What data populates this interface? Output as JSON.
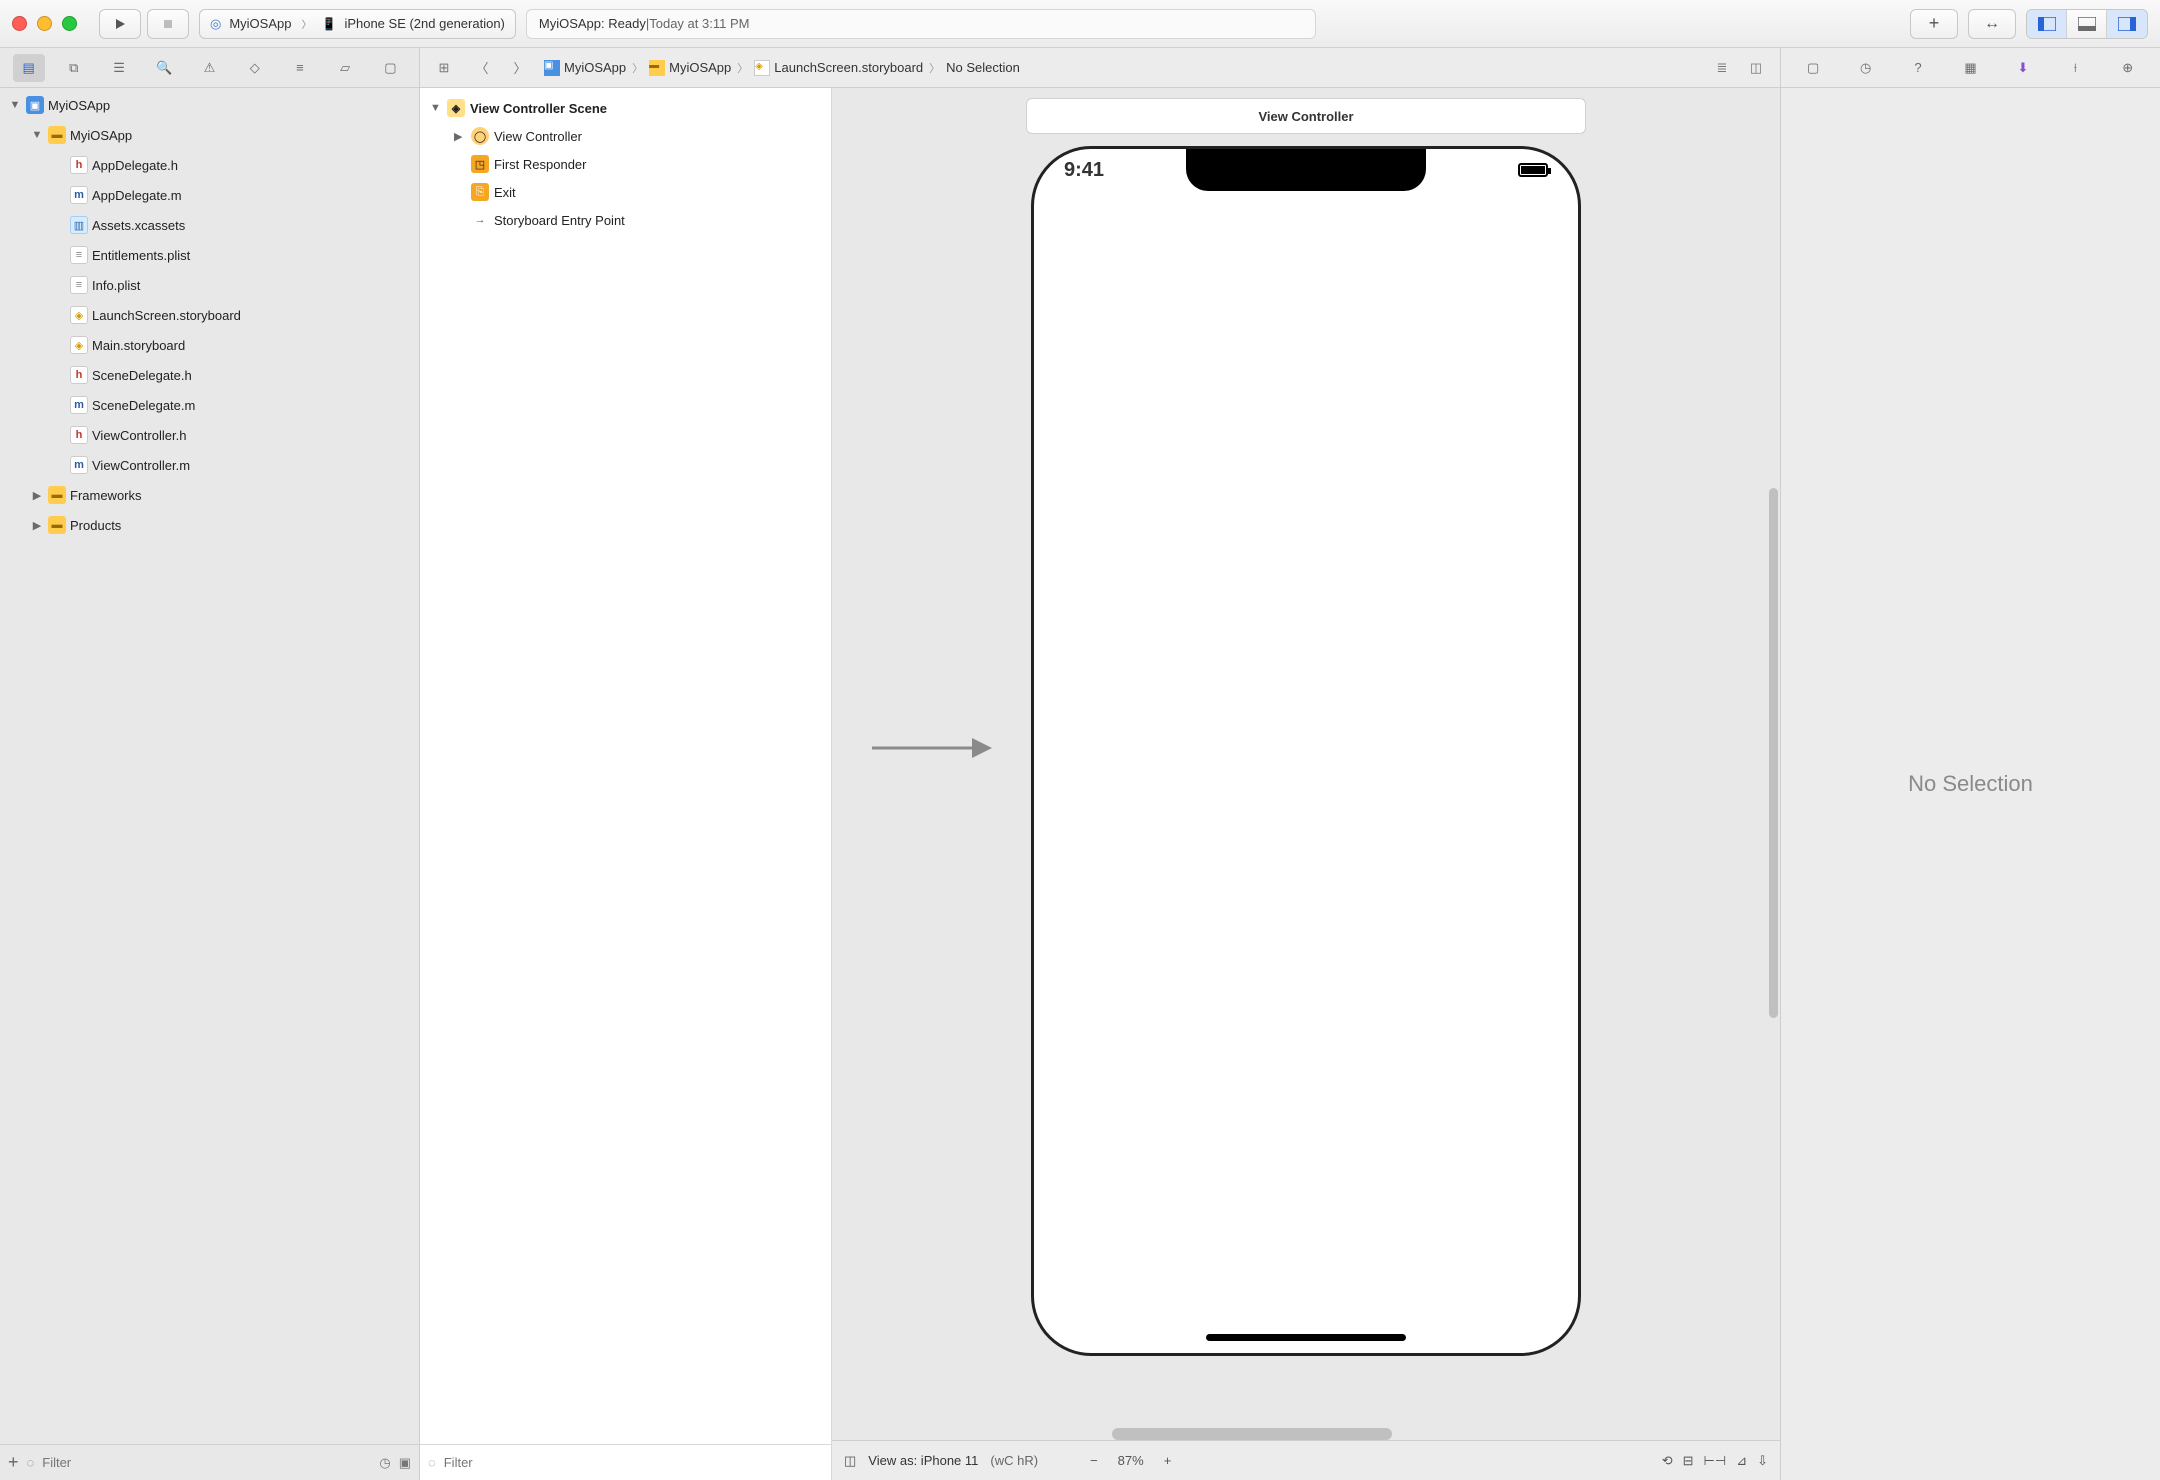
{
  "titlebar": {
    "scheme_app": "MyiOSApp",
    "scheme_device": "iPhone SE (2nd generation)",
    "status_app": "MyiOSApp:",
    "status_state": "Ready",
    "status_sep": " | ",
    "status_time": "Today at 3:11 PM"
  },
  "navigator": {
    "filter_placeholder": "Filter",
    "items": [
      {
        "indent": 0,
        "disclosure": "▼",
        "icon": "app",
        "label": "MyiOSApp"
      },
      {
        "indent": 1,
        "disclosure": "▼",
        "icon": "folder",
        "label": "MyiOSApp"
      },
      {
        "indent": 2,
        "disclosure": "",
        "icon": "fileh",
        "label": "AppDelegate.h"
      },
      {
        "indent": 2,
        "disclosure": "",
        "icon": "filem",
        "label": "AppDelegate.m"
      },
      {
        "indent": 2,
        "disclosure": "",
        "icon": "assets",
        "label": "Assets.xcassets"
      },
      {
        "indent": 2,
        "disclosure": "",
        "icon": "plist",
        "label": "Entitlements.plist"
      },
      {
        "indent": 2,
        "disclosure": "",
        "icon": "plist",
        "label": "Info.plist"
      },
      {
        "indent": 2,
        "disclosure": "",
        "icon": "story",
        "label": "LaunchScreen.storyboard"
      },
      {
        "indent": 2,
        "disclosure": "",
        "icon": "story",
        "label": "Main.storyboard"
      },
      {
        "indent": 2,
        "disclosure": "",
        "icon": "fileh",
        "label": "SceneDelegate.h"
      },
      {
        "indent": 2,
        "disclosure": "",
        "icon": "filem",
        "label": "SceneDelegate.m"
      },
      {
        "indent": 2,
        "disclosure": "",
        "icon": "fileh",
        "label": "ViewController.h"
      },
      {
        "indent": 2,
        "disclosure": "",
        "icon": "filem",
        "label": "ViewController.m"
      },
      {
        "indent": 1,
        "disclosure": "▶",
        "icon": "folder",
        "label": "Frameworks"
      },
      {
        "indent": 1,
        "disclosure": "▶",
        "icon": "folder",
        "label": "Products"
      }
    ]
  },
  "jumpbar": {
    "crumbs": [
      {
        "icon": "app",
        "label": "MyiOSApp"
      },
      {
        "icon": "folder",
        "label": "MyiOSApp"
      },
      {
        "icon": "story",
        "label": "LaunchScreen.storyboard"
      },
      {
        "icon": "",
        "label": "No Selection"
      }
    ]
  },
  "outline": {
    "filter_placeholder": "Filter",
    "rows": [
      {
        "indent": 0,
        "disc": "▼",
        "icon": "scene",
        "label": "View Controller Scene",
        "bold": true
      },
      {
        "indent": 1,
        "disc": "▶",
        "icon": "vc",
        "label": "View Controller"
      },
      {
        "indent": 1,
        "disc": "",
        "icon": "fr",
        "label": "First Responder"
      },
      {
        "indent": 1,
        "disc": "",
        "icon": "exit",
        "label": "Exit"
      },
      {
        "indent": 1,
        "disc": "",
        "icon": "arrow",
        "label": "Storyboard Entry Point"
      }
    ]
  },
  "canvas": {
    "scene_title": "View Controller",
    "status_time": "9:41",
    "footer_viewas": "View as: iPhone 11",
    "footer_traits": "(wC hR)",
    "zoom": "87%"
  },
  "inspector": {
    "empty": "No Selection"
  }
}
